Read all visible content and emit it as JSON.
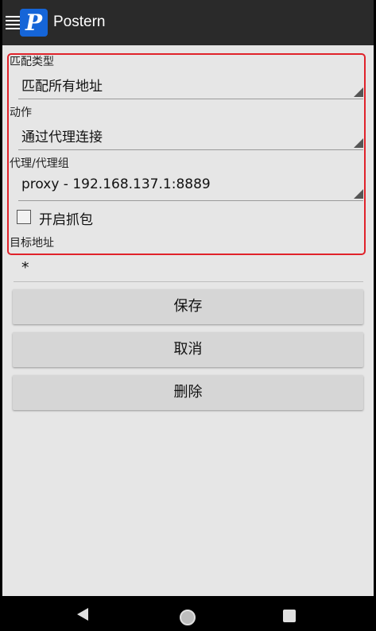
{
  "app": {
    "title": "Postern",
    "logo_letter": "P"
  },
  "form": {
    "match_type": {
      "label": "匹配类型",
      "value": "匹配所有地址"
    },
    "action": {
      "label": "动作",
      "value": "通过代理连接"
    },
    "proxy": {
      "label": "代理/代理组",
      "value": "proxy - 192.168.137.1:8889"
    },
    "capture": {
      "label": "开启抓包",
      "checked": false
    },
    "target": {
      "label": "目标地址",
      "value": "*"
    }
  },
  "buttons": {
    "save": "保存",
    "cancel": "取消",
    "delete": "删除"
  },
  "colors": {
    "appbar": "#2a2a2a",
    "logo": "#1565d8",
    "highlight": "#e0222a",
    "background": "#e6e6e6"
  },
  "nav": {
    "back_icon": "back-triangle-icon",
    "home_icon": "home-circle-icon",
    "recent_icon": "recents-square-icon"
  }
}
